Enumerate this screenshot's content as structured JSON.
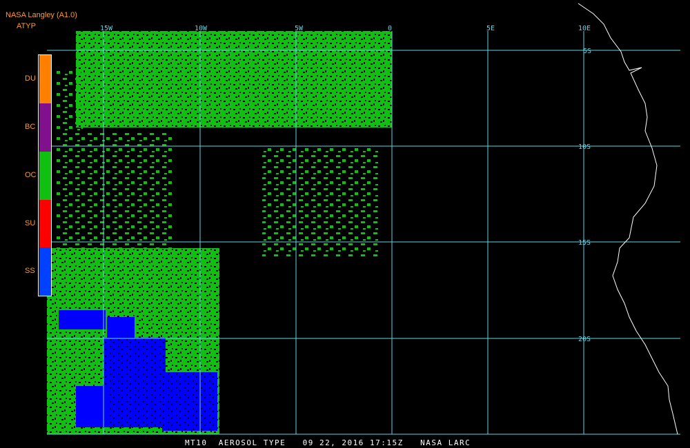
{
  "header": {
    "organization": "NASA Langley (A1.0)",
    "product": "ATYP"
  },
  "legend": {
    "classes": [
      {
        "code": "DU",
        "color": "#ff8000"
      },
      {
        "code": "BC",
        "color": "#80108c"
      },
      {
        "code": "OC",
        "color": "#10c010"
      },
      {
        "code": "SU",
        "color": "#ff0000"
      },
      {
        "code": "SS",
        "color": "#0040ff"
      }
    ]
  },
  "map": {
    "longitude_labels": [
      "15W",
      "10W",
      "5W",
      "0",
      "5E",
      "10E"
    ],
    "latitude_labels": [
      "5S",
      "10S",
      "15S",
      "20S"
    ],
    "grid_color": "#5fd6e8",
    "coastline_color": "#ffffff",
    "data_colors": {
      "organic_carbon": "#10c010",
      "sea_salt": "#0000ff"
    }
  },
  "footer": {
    "caption": "MT10  AEROSOL TYPE   09 22, 2016 17:15Z   NASA LARC"
  }
}
